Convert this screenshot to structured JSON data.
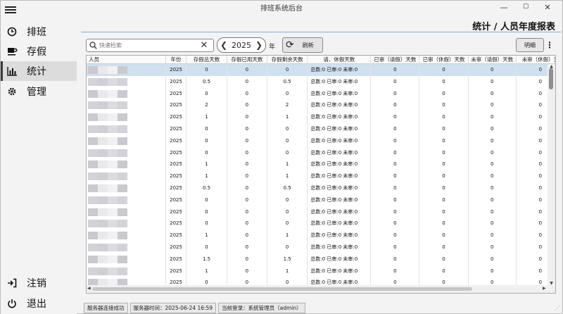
{
  "window": {
    "title": "排班系统后台",
    "controls": [
      "—",
      "☐",
      "✕"
    ]
  },
  "sidebar": {
    "items": [
      {
        "label": "排班",
        "icon": "clock-icon"
      },
      {
        "label": "存假",
        "icon": "coffee-icon"
      },
      {
        "label": "统计",
        "icon": "bar-chart-icon",
        "active": true
      },
      {
        "label": "管理",
        "icon": "gear-icon"
      }
    ],
    "bottom": [
      {
        "label": "注销",
        "icon": "logout-icon"
      },
      {
        "label": "退出",
        "icon": "power-icon"
      }
    ]
  },
  "header": {
    "title": "统计 / 人员年度报表"
  },
  "toolbar": {
    "search_placeholder": "快速检索",
    "year": "2025",
    "year_unit": "年",
    "refresh_label": "刷新",
    "detail_label": "明细",
    "more_label": "⋮"
  },
  "table": {
    "headers": [
      "人员",
      "年份",
      "存假总天数",
      "存假已用天数",
      "存假剩余天数",
      "请、休假天数",
      "已审（请假）天数",
      "已审（休假）天数",
      "未审（请假）天数",
      "未审（休假）天"
    ],
    "rows": [
      [
        "2025",
        "0",
        "0",
        "0",
        "总数:0 已审:0 未审:0",
        "0",
        "0",
        "0",
        "0"
      ],
      [
        "2025",
        "0.5",
        "0",
        "0.5",
        "总数:0 已审:0 未审:0",
        "0",
        "0",
        "0",
        "0"
      ],
      [
        "2025",
        "0",
        "0",
        "0",
        "总数:0 已审:0 未审:0",
        "0",
        "0",
        "0",
        "0"
      ],
      [
        "2025",
        "2",
        "0",
        "2",
        "总数:0 已审:0 未审:0",
        "0",
        "0",
        "0",
        "0"
      ],
      [
        "2025",
        "1",
        "0",
        "1",
        "总数:0 已审:0 未审:0",
        "0",
        "0",
        "0",
        "0"
      ],
      [
        "2025",
        "0",
        "0",
        "0",
        "总数:0 已审:0 未审:0",
        "0",
        "0",
        "0",
        "0"
      ],
      [
        "2025",
        "0",
        "0",
        "0",
        "总数:0 已审:0 未审:0",
        "0",
        "0",
        "0",
        "0"
      ],
      [
        "2025",
        "0",
        "0",
        "0",
        "总数:0 已审:0 未审:0",
        "0",
        "0",
        "0",
        "0"
      ],
      [
        "2025",
        "1",
        "0",
        "1",
        "总数:0 已审:0 未审:0",
        "0",
        "0",
        "0",
        "0"
      ],
      [
        "2025",
        "1",
        "0",
        "1",
        "总数:0 已审:0 未审:0",
        "0",
        "0",
        "0",
        "0"
      ],
      [
        "2025",
        "0.5",
        "0",
        "0.5",
        "总数:0 已审:0 未审:0",
        "0",
        "0",
        "0",
        "0"
      ],
      [
        "2025",
        "0",
        "0",
        "0",
        "总数:0 已审:0 未审:0",
        "0",
        "0",
        "0",
        "0"
      ],
      [
        "2025",
        "0",
        "0",
        "0",
        "总数:0 已审:0 未审:0",
        "0",
        "0",
        "0",
        "0"
      ],
      [
        "2025",
        "0",
        "0",
        "0",
        "总数:0 已审:0 未审:0",
        "0",
        "0",
        "0",
        "0"
      ],
      [
        "2025",
        "1",
        "0",
        "1",
        "总数:0 已审:0 未审:0",
        "0",
        "0",
        "0",
        "0"
      ],
      [
        "2025",
        "0",
        "0",
        "0",
        "总数:0 已审:0 未审:0",
        "0",
        "0",
        "0",
        "0"
      ],
      [
        "2025",
        "1.5",
        "0",
        "1.5",
        "总数:0 已审:0 未审:0",
        "0",
        "0",
        "0",
        "0"
      ],
      [
        "2025",
        "1",
        "0",
        "1",
        "总数:0 已审:0 未审:0",
        "0",
        "0",
        "0",
        "0"
      ],
      [
        "2025",
        "0",
        "0",
        "0",
        "总数:0 已审:0 未审:0",
        "0",
        "0",
        "0",
        "0"
      ]
    ]
  },
  "statusbar": {
    "connection": "服务器连接成功",
    "server_time": "服务器时间：2025-06-24 16:59",
    "current_user": "当前登录：系统管理员（admin）"
  },
  "colors": {
    "selected_row": "#cfe1f1",
    "title_line": "#7faedc",
    "active_nav": "#dcdcdc"
  }
}
